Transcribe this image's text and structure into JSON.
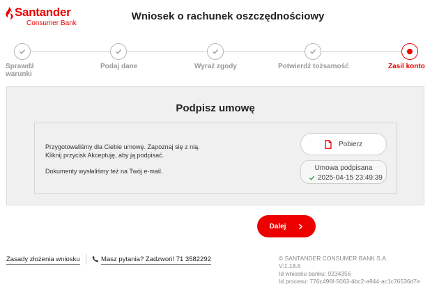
{
  "brand": {
    "name": "Santander",
    "subtitle": "Consumer Bank",
    "color": "#ec0000"
  },
  "page": {
    "title": "Wniosek o rachunek oszczędnościowy"
  },
  "stepper": {
    "steps": [
      {
        "label_line1": "Sprawdź",
        "label_line2": "warunki",
        "state": "done"
      },
      {
        "label_line1": "Podaj dane",
        "label_line2": "",
        "state": "done"
      },
      {
        "label_line1": "Wyraź zgody",
        "label_line2": "",
        "state": "done"
      },
      {
        "label_line1": "Potwierdź tożsamość",
        "label_line2": "",
        "state": "done"
      },
      {
        "label_line1": "Zasil konto",
        "label_line2": "",
        "state": "current"
      }
    ]
  },
  "card": {
    "title": "Podpisz umowę",
    "message_line1": "Przygotowaliśmy dla Ciebie umowę. Zapoznaj się z nią.",
    "message_line2": "Kliknij przycisk Akceptuję, aby ją podpisać.",
    "message_line3": "Dokumenty wysłaliśmy też na Twój e-mail.",
    "download_label": "Pobierz",
    "download_icon": "document-icon",
    "signed_title": "Umowa podpisana",
    "signed_date": "2025-04-15 23:49:39",
    "signed_icon": "check-icon"
  },
  "actions": {
    "next_label": "Dalej",
    "next_icon": "chevron-right-icon"
  },
  "footer": {
    "rules_link": "Zasady złożenia wniosku",
    "phone_link": "Masz pytania? Zadzwoń! 71 3582292",
    "phone_icon": "phone-icon",
    "copyright": "© SANTANDER CONSUMER BANK S.A.",
    "version": "V:1.18.6",
    "application_id": "Id wniosku banku: 9234356",
    "process_id": "Id procesu: 776c496f-5063-4bc2-a944-ac1c76536d7e"
  }
}
